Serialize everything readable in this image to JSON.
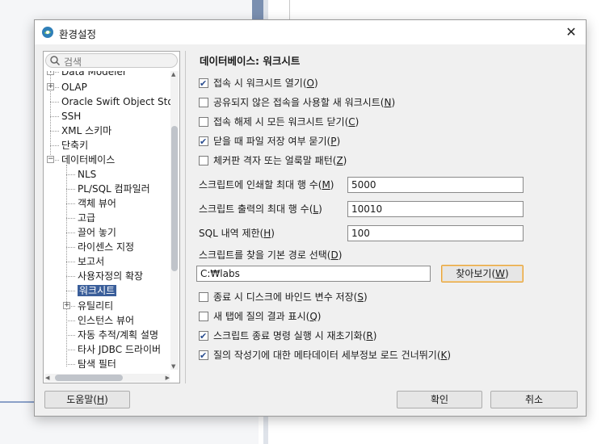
{
  "dialog": {
    "title": "환경설정",
    "close_icon": "✕"
  },
  "search": {
    "placeholder": "검색"
  },
  "tree": {
    "items": [
      {
        "label": "Data Modeler"
      },
      {
        "label": "OLAP"
      },
      {
        "label": "Oracle Swift Object Sto"
      },
      {
        "label": "SSH"
      },
      {
        "label": "XML 스키마"
      },
      {
        "label": "단축키"
      },
      {
        "label": "데이터베이스"
      },
      {
        "label": "NLS"
      },
      {
        "label": "PL/SQL 컴파일러"
      },
      {
        "label": "객체 뷰어"
      },
      {
        "label": "고급"
      },
      {
        "label": "끌어 놓기"
      },
      {
        "label": "라이센스 지정"
      },
      {
        "label": "보고서"
      },
      {
        "label": "사용자정의 확장"
      },
      {
        "label": "워크시트"
      },
      {
        "label": "유틸리티"
      },
      {
        "label": "인스턴스 뷰어"
      },
      {
        "label": "자동 추적/계획 설명"
      },
      {
        "label": "타사 JDBC 드라이버"
      },
      {
        "label": "탐색 필터"
      }
    ]
  },
  "panel": {
    "title": "데이터베이스: 워크시트",
    "checks_top": [
      {
        "text": "접속 시 워크시트 열기",
        "key": "O",
        "checked": true
      },
      {
        "text": "공유되지 않은 접속을 사용할 새 워크시트",
        "key": "N",
        "checked": false
      },
      {
        "text": "접속 해제 시 모든 워크시트 닫기",
        "key": "C",
        "checked": false
      },
      {
        "text": "닫을 때 파일 저장 여부 묻기",
        "key": "P",
        "checked": true
      },
      {
        "text": "체커판 격자 또는 얼룩말 패턴",
        "key": "Z",
        "checked": false
      }
    ],
    "fields": [
      {
        "text": "스크립트에 인쇄할 최대 행 수",
        "key": "M",
        "value": "5000"
      },
      {
        "text": "스크립트 출력의 최대 행 수",
        "key": "L",
        "value": "10010"
      },
      {
        "text": "SQL 내역 제한",
        "key": "H",
        "value": "100"
      }
    ],
    "path": {
      "text": "스크립트를 찾을 기본 경로 선택",
      "key": "D",
      "value": "C:₩labs",
      "browse_text": "찾아보기",
      "browse_key": "W"
    },
    "checks_bottom": [
      {
        "text": "종료 시 디스크에 바인드 변수 저장",
        "key": "S",
        "checked": false
      },
      {
        "text": "새 탭에 질의 결과 표시",
        "key": "Q",
        "checked": false
      },
      {
        "text": "스크립트 종료 명령 실행 시 재초기화",
        "key": "R",
        "checked": true
      },
      {
        "text": "질의 작성기에 대한 메타데이터 세부정보 로드 건너뛰기",
        "key": "K",
        "checked": true
      }
    ]
  },
  "footer": {
    "help_text": "도움말",
    "help_key": "H",
    "ok_label": "확인",
    "cancel_label": "취소"
  }
}
